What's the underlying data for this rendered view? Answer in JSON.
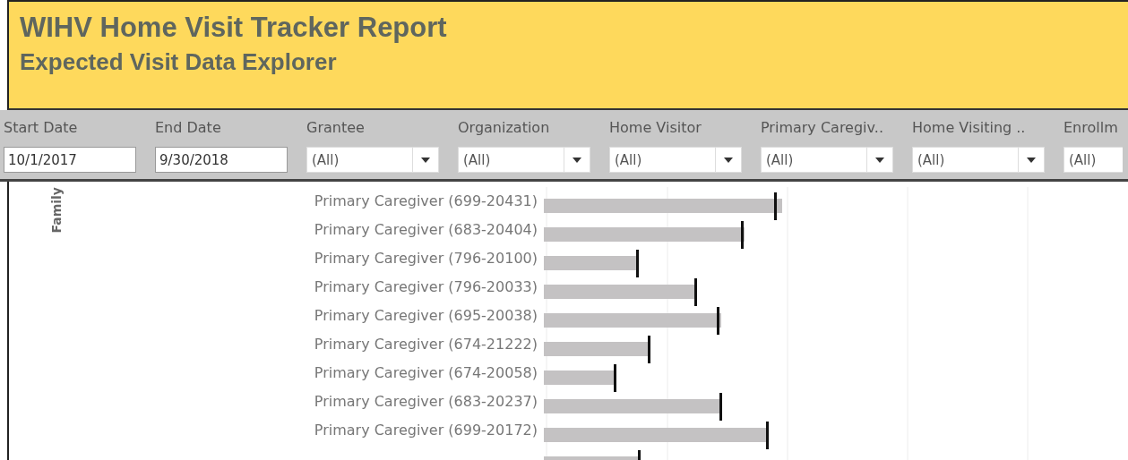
{
  "header": {
    "title": "WIHV Home Visit Tracker Report",
    "subtitle": "Expected Visit Data Explorer"
  },
  "filters": [
    {
      "label": "Start Date",
      "kind": "date",
      "value": "10/1/2017"
    },
    {
      "label": "End Date",
      "kind": "date",
      "value": "9/30/2018"
    },
    {
      "label": "Grantee",
      "kind": "dropdown",
      "value": "(All)"
    },
    {
      "label": "Organization",
      "kind": "dropdown",
      "value": "(All)"
    },
    {
      "label": "Home Visitor",
      "kind": "dropdown",
      "value": "(All)"
    },
    {
      "label": "Primary Caregiv..",
      "kind": "dropdown",
      "value": "(All)"
    },
    {
      "label": "Home Visiting ..",
      "kind": "dropdown",
      "value": "(All)"
    },
    {
      "label": "Enrollm",
      "kind": "cut",
      "value": "(All)"
    }
  ],
  "chart": {
    "axis_label": "Family",
    "rows": [
      {
        "label": "Primary Caregiver (699-20431)"
      },
      {
        "label": "Primary Caregiver (683-20404)"
      },
      {
        "label": "Primary Caregiver (796-20100)"
      },
      {
        "label": "Primary Caregiver (796-20033)"
      },
      {
        "label": "Primary Caregiver (695-20038)"
      },
      {
        "label": "Primary Caregiver (674-21222)"
      },
      {
        "label": "Primary Caregiver (674-20058)"
      },
      {
        "label": "Primary Caregiver (683-20237)"
      },
      {
        "label": "Primary Caregiver (699-20172)"
      }
    ]
  }
}
